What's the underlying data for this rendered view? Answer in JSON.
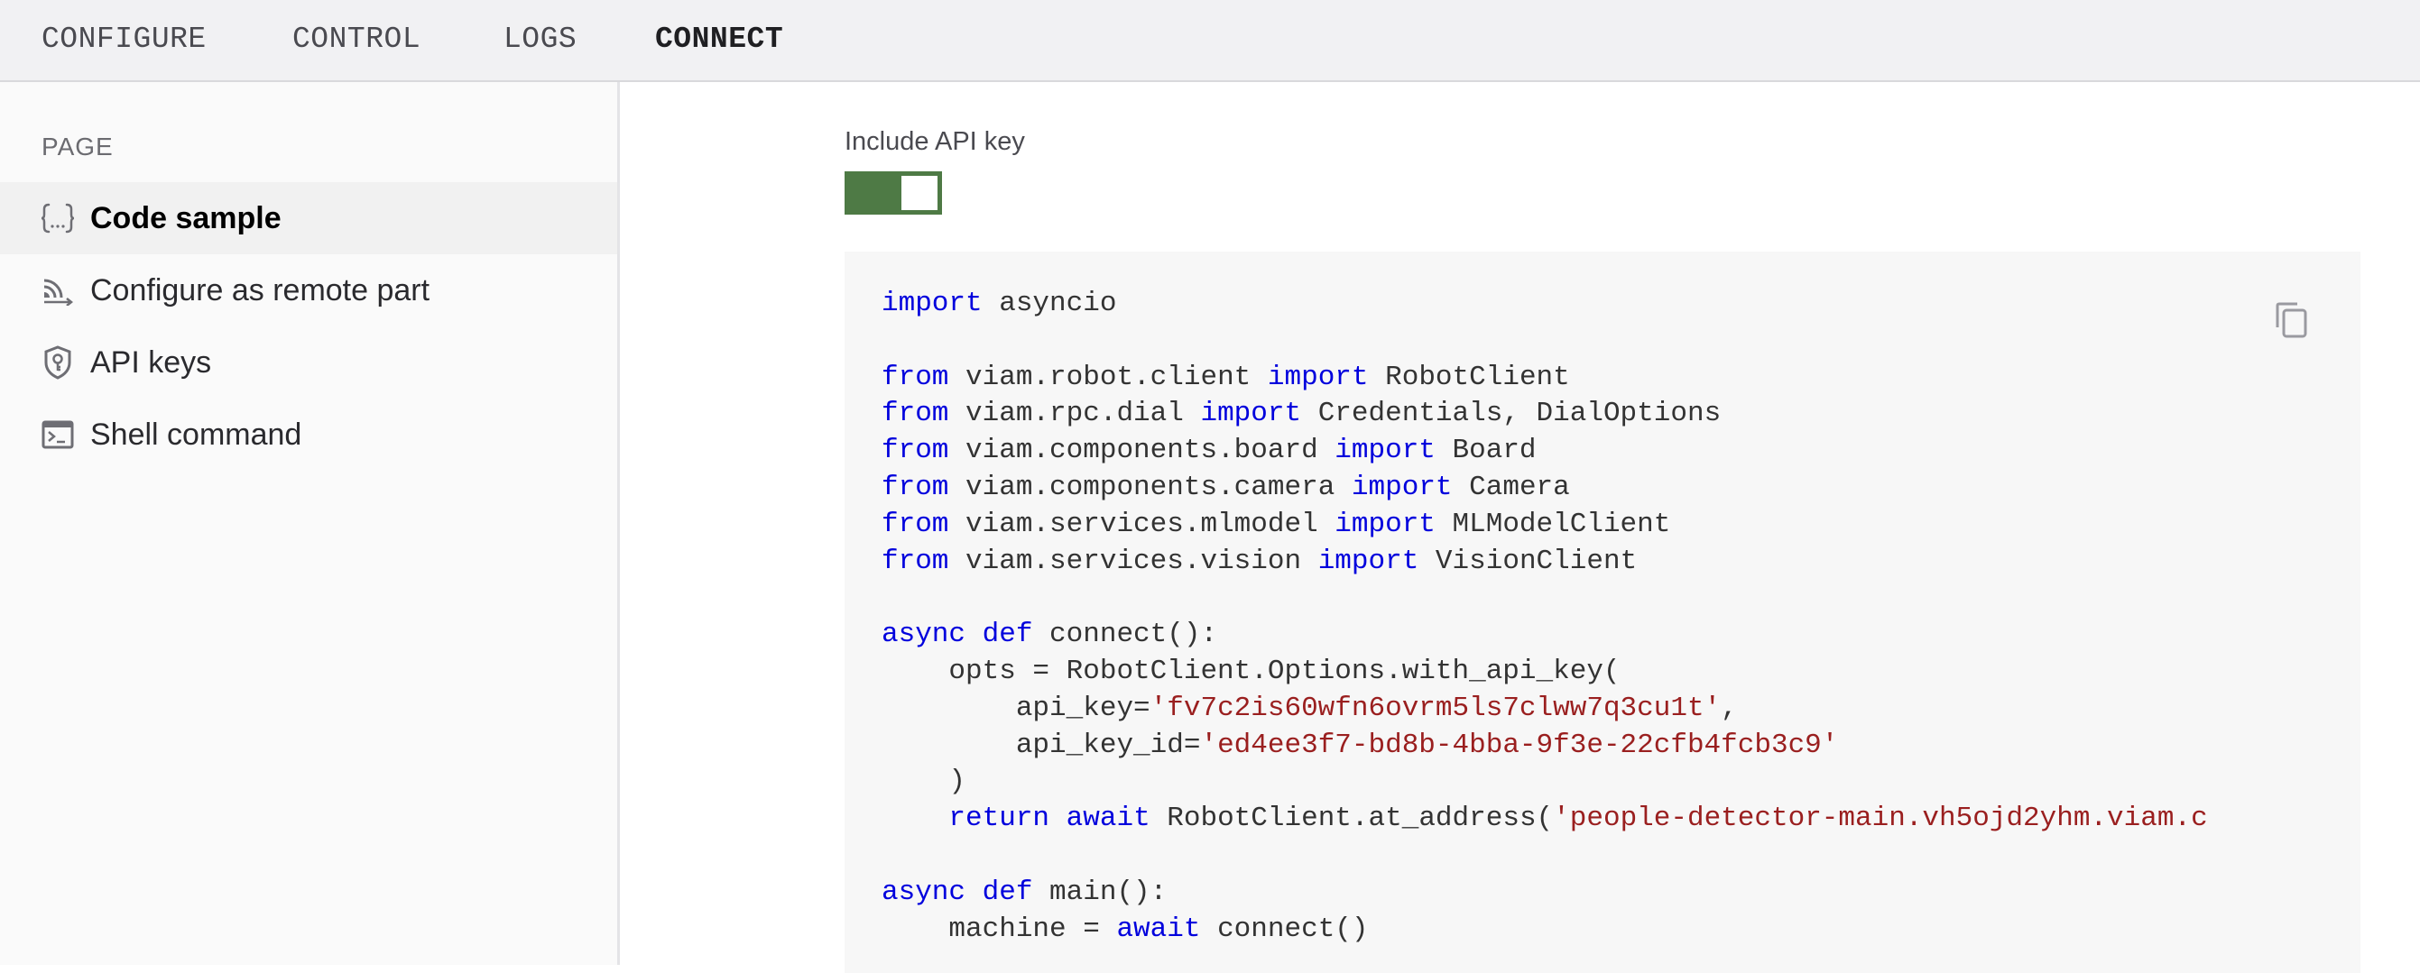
{
  "tabs": [
    {
      "label": "CONFIGURE",
      "active": false
    },
    {
      "label": "CONTROL",
      "active": false
    },
    {
      "label": "LOGS",
      "active": false
    },
    {
      "label": "CONNECT",
      "active": true
    }
  ],
  "sidebar": {
    "heading": "PAGE",
    "items": [
      {
        "label": "Code sample",
        "icon": "code-braces-icon",
        "active": true
      },
      {
        "label": "Configure as remote part",
        "icon": "remote-signal-icon",
        "active": false
      },
      {
        "label": "API keys",
        "icon": "shield-key-icon",
        "active": false
      },
      {
        "label": "Shell command",
        "icon": "terminal-icon",
        "active": false
      }
    ]
  },
  "main": {
    "toggle_label": "Include API key",
    "toggle_on": true,
    "toggle_color": "#4e7a45",
    "copy_icon": "copy-icon",
    "code_lines": [
      [
        [
          "kw",
          "import"
        ],
        [
          "t",
          " asyncio"
        ]
      ],
      [],
      [
        [
          "kw",
          "from"
        ],
        [
          "t",
          " viam.robot.client "
        ],
        [
          "kw",
          "import"
        ],
        [
          "t",
          " RobotClient"
        ]
      ],
      [
        [
          "kw",
          "from"
        ],
        [
          "t",
          " viam.rpc.dial "
        ],
        [
          "kw",
          "import"
        ],
        [
          "t",
          " Credentials, DialOptions"
        ]
      ],
      [
        [
          "kw",
          "from"
        ],
        [
          "t",
          " viam.components.board "
        ],
        [
          "kw",
          "import"
        ],
        [
          "t",
          " Board"
        ]
      ],
      [
        [
          "kw",
          "from"
        ],
        [
          "t",
          " viam.components.camera "
        ],
        [
          "kw",
          "import"
        ],
        [
          "t",
          " Camera"
        ]
      ],
      [
        [
          "kw",
          "from"
        ],
        [
          "t",
          " viam.services.mlmodel "
        ],
        [
          "kw",
          "import"
        ],
        [
          "t",
          " MLModelClient"
        ]
      ],
      [
        [
          "kw",
          "from"
        ],
        [
          "t",
          " viam.services.vision "
        ],
        [
          "kw",
          "import"
        ],
        [
          "t",
          " VisionClient"
        ]
      ],
      [],
      [
        [
          "kw",
          "async"
        ],
        [
          "t",
          " "
        ],
        [
          "kw",
          "def"
        ],
        [
          "t",
          " connect():"
        ]
      ],
      [
        [
          "t",
          "    opts = RobotClient.Options.with_api_key("
        ]
      ],
      [
        [
          "t",
          "        api_key="
        ],
        [
          "str",
          "'fv7c2is60wfn6ovrm5ls7clww7q3cu1t'"
        ],
        [
          "t",
          ","
        ]
      ],
      [
        [
          "t",
          "        api_key_id="
        ],
        [
          "str",
          "'ed4ee3f7-bd8b-4bba-9f3e-22cfb4fcb3c9'"
        ]
      ],
      [
        [
          "t",
          "    )"
        ]
      ],
      [
        [
          "t",
          "    "
        ],
        [
          "kw",
          "return"
        ],
        [
          "t",
          " "
        ],
        [
          "kw",
          "await"
        ],
        [
          "t",
          " RobotClient.at_address("
        ],
        [
          "str",
          "'people-detector-main.vh5ojd2yhm.viam.c"
        ]
      ],
      [],
      [
        [
          "kw",
          "async"
        ],
        [
          "t",
          " "
        ],
        [
          "kw",
          "def"
        ],
        [
          "t",
          " main():"
        ]
      ],
      [
        [
          "t",
          "    machine = "
        ],
        [
          "kw",
          "await"
        ],
        [
          "t",
          " connect()"
        ]
      ]
    ]
  }
}
